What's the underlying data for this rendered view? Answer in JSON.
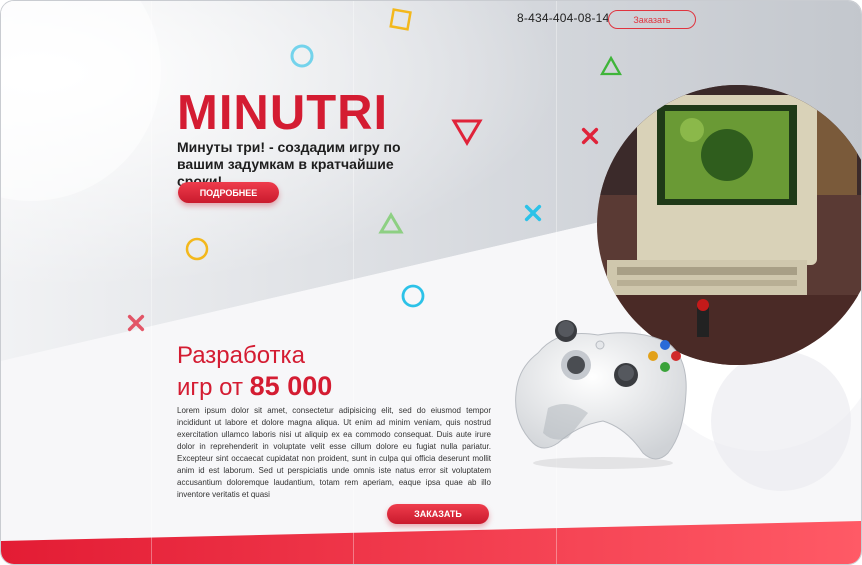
{
  "header": {
    "phone": "8-434-404-08-14",
    "order_label": "Заказать"
  },
  "hero": {
    "title": "MINUTRI",
    "subtitle": "Минуты три! - создадим игру по вашим задумкам в кратчайшие сроки!",
    "more_label": "ПОДРОБНЕЕ"
  },
  "dev": {
    "title_line1": "Разработка",
    "title_line2_prefix": "игр от ",
    "price": "85 000",
    "text": "Lorem ipsum dolor sit amet, consectetur adipisicing elit, sed do eiusmod tempor incididunt ut labore et dolore magna aliqua. Ut enim ad minim veniam, quis nostrud exercitation ullamco laboris nisi ut aliquip ex ea commodo consequat. Duis aute irure dolor in reprehenderit in voluptate velit esse cillum dolore eu fugiat nulla pariatur. Excepteur sint occaecat cupidatat non proident, sunt in culpa qui officia deserunt mollit anim id est laborum. Sed ut perspiciatis unde omnis iste natus error sit voluptatem accusantium doloremque laudantium, totam rem aperiam, eaque ipsa quae ab illo inventore veritatis et quasi",
    "order_label": "ЗАКАЗАТЬ"
  },
  "colors": {
    "accent": "#d41c32",
    "button": "#e0343f",
    "cyan": "#3ec6e8",
    "green": "#3fb53a",
    "yellow": "#f3b81c",
    "background": "#f4f5f7"
  },
  "icons": [
    "square-icon",
    "circle-icon",
    "triangle-icon",
    "cross-icon",
    "retro-computer-photo",
    "gamepad-image"
  ]
}
